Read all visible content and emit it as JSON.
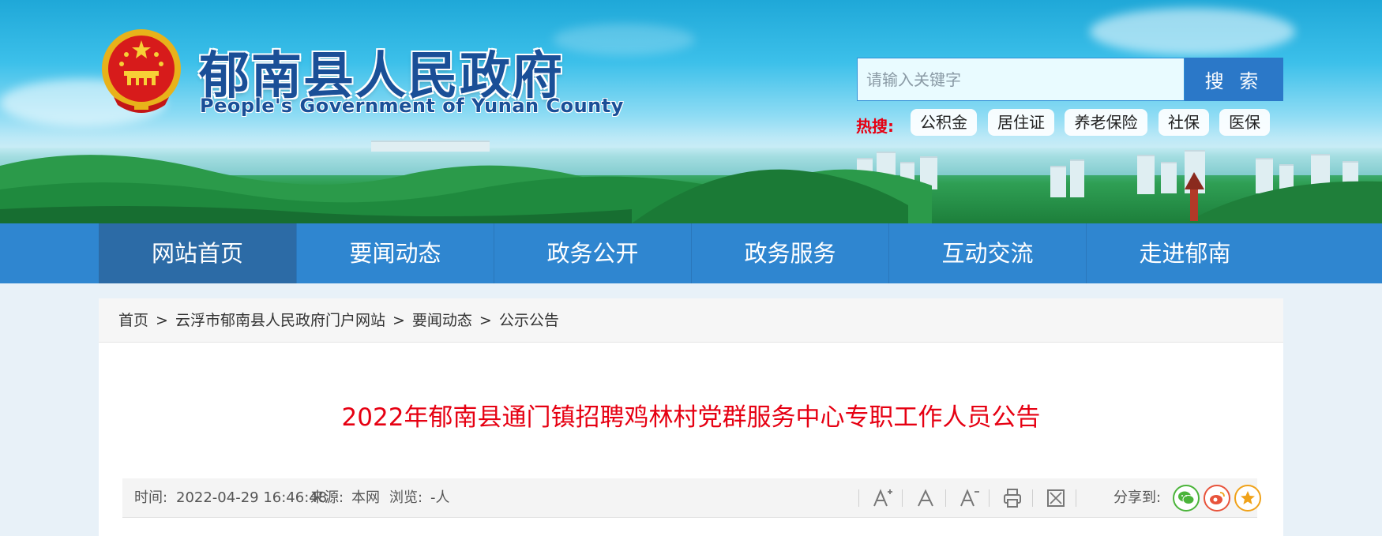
{
  "header": {
    "title": "郁南县人民政府",
    "subtitle": "People's Government of Yunan County",
    "search": {
      "placeholder": "请输入关键字",
      "button_label": "搜 索"
    },
    "hot_search": {
      "label": "热搜:",
      "tags": [
        "公积金",
        "居住证",
        "养老保险",
        "社保",
        "医保"
      ]
    }
  },
  "nav": {
    "items": [
      "网站首页",
      "要闻动态",
      "政务公开",
      "政务服务",
      "互动交流",
      "走进郁南"
    ],
    "active_index": 0
  },
  "breadcrumb": {
    "items": [
      "首页",
      "云浮市郁南县人民政府门户网站",
      "要闻动态",
      "公示公告"
    ],
    "separator": ">"
  },
  "article": {
    "title": "2022年郁南县通门镇招聘鸡林村党群服务中心专职工作人员公告",
    "meta": {
      "time_label": "时间:",
      "time_value": "2022-04-29 16:46:48",
      "source_label": "来源:",
      "source_value": "本网",
      "views_label": "浏览:",
      "views_value": "-人"
    },
    "tools": {
      "icons": [
        "font-increase-icon",
        "font-normal-icon",
        "font-decrease-icon",
        "print-icon",
        "close-icon"
      ],
      "share_label": "分享到:",
      "share_icons": [
        "wechat-icon",
        "weibo-icon",
        "favorite-icon"
      ]
    }
  },
  "colors": {
    "nav_bg": "#2f86d0",
    "nav_active": "#2c6ba6",
    "title_red": "#e60012",
    "search_btn": "#2b78c8",
    "brand_blue": "#1a4f97",
    "wechat": "#4bb43a",
    "weibo": "#e8543c",
    "favorite": "#f0a21a"
  }
}
